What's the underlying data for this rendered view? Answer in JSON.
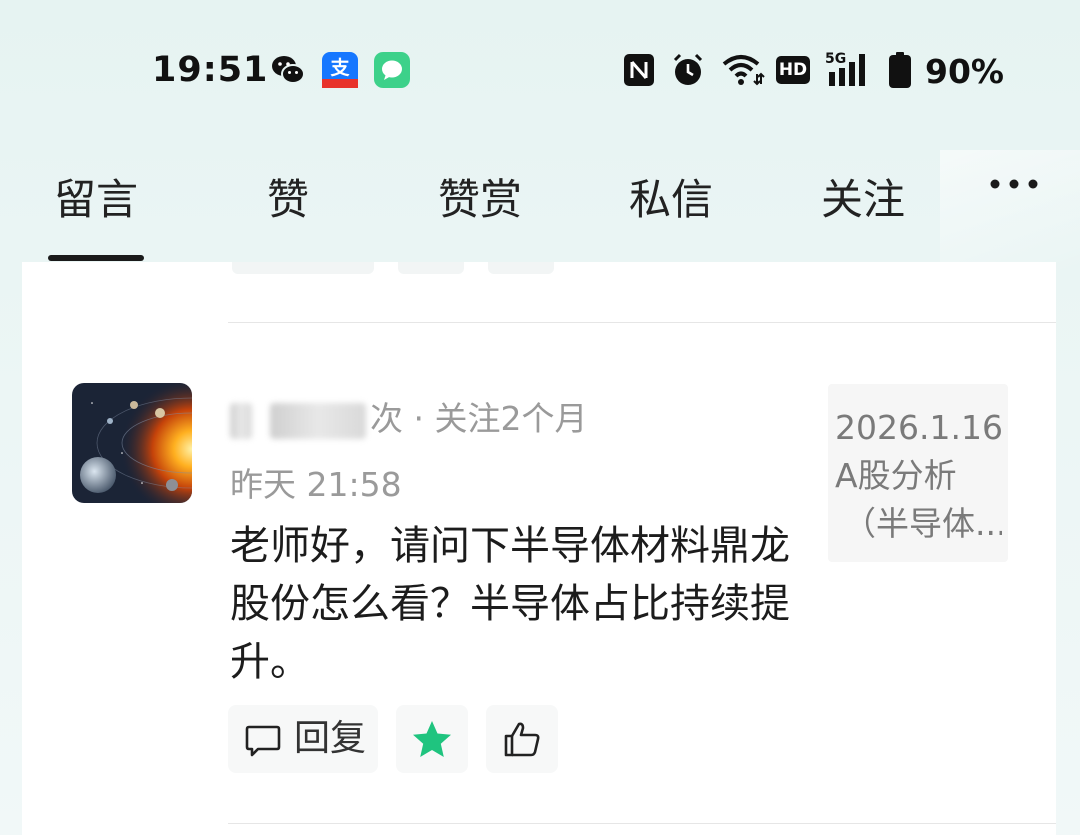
{
  "status_bar": {
    "time": "19:51",
    "battery": "90%",
    "app_icons": [
      "wechat-icon",
      "alipay-icon",
      "messages-icon"
    ],
    "indicators": [
      "nfc-icon",
      "alarm-icon",
      "wifi-icon",
      "hd-icon",
      "5g-signal-icon",
      "battery-icon"
    ],
    "network_label": "5G",
    "hd_label": "HD"
  },
  "tabs": [
    {
      "label": "留言",
      "active": true
    },
    {
      "label": "赞",
      "active": false
    },
    {
      "label": "赞赏",
      "active": false
    },
    {
      "label": "私信",
      "active": false
    },
    {
      "label": "关注",
      "active": false
    }
  ],
  "more_icon": "more-icon",
  "comment": {
    "meta_suffix": "次 · 关注2个月",
    "time": "昨天 21:58",
    "text": "老师好，请问下半导体材料鼎龙股份怎么看？半导体占比持续提升。",
    "article": {
      "line1": "2026.1.16",
      "line2": "A股分析",
      "line3": "（半导体..."
    },
    "actions": {
      "reply_label": "回复",
      "star_icon": "star-icon",
      "like_icon": "thumbs-up-icon"
    }
  },
  "colors": {
    "accent_star": "#1fc47f",
    "background": "#e8f4f3",
    "card": "#ffffff",
    "meta_text": "#9a9a9a"
  }
}
